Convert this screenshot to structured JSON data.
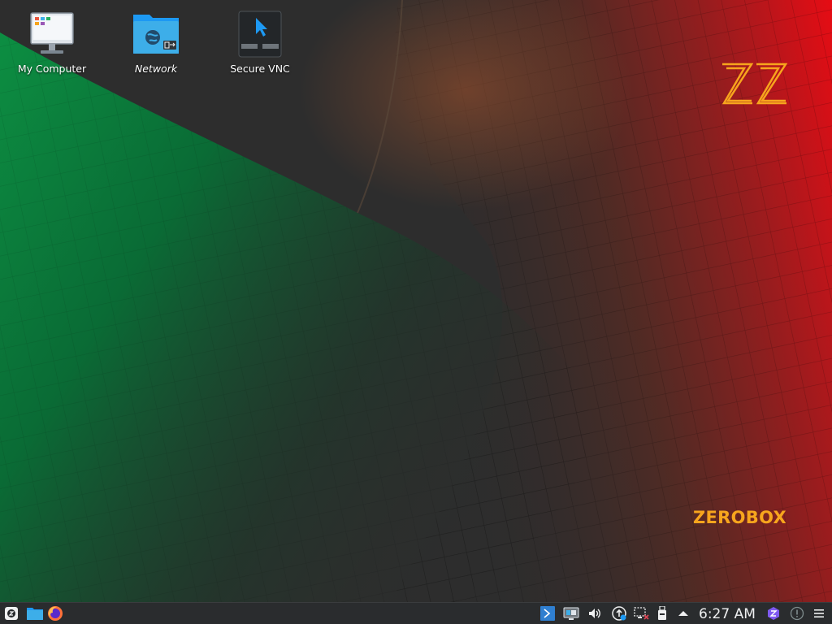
{
  "desktop": {
    "icons": [
      {
        "label": "My Computer",
        "icon": "computer-icon"
      },
      {
        "label": "Network",
        "icon": "network-folder-icon"
      },
      {
        "label": "Secure VNC",
        "icon": "vnc-icon"
      }
    ],
    "brand": {
      "text": "ZEROBOX",
      "logo": "zz-logo",
      "color": "#f7a51d"
    }
  },
  "taskbar": {
    "launchers": [
      "app-menu-icon",
      "file-manager-icon",
      "firefox-icon"
    ],
    "tray": [
      "terminal-icon",
      "display-icon",
      "volume-icon",
      "update-icon",
      "network-disconnected-icon",
      "usb-drive-icon",
      "show-hidden-icons-arrow",
      "vpn-shield-icon",
      "notifications-icon",
      "menu-icon"
    ],
    "clock": "6:27 AM"
  },
  "colors": {
    "taskbar": "#2a2c2e",
    "accent_red": "#e31018",
    "accent_green": "#0f8a3e"
  }
}
